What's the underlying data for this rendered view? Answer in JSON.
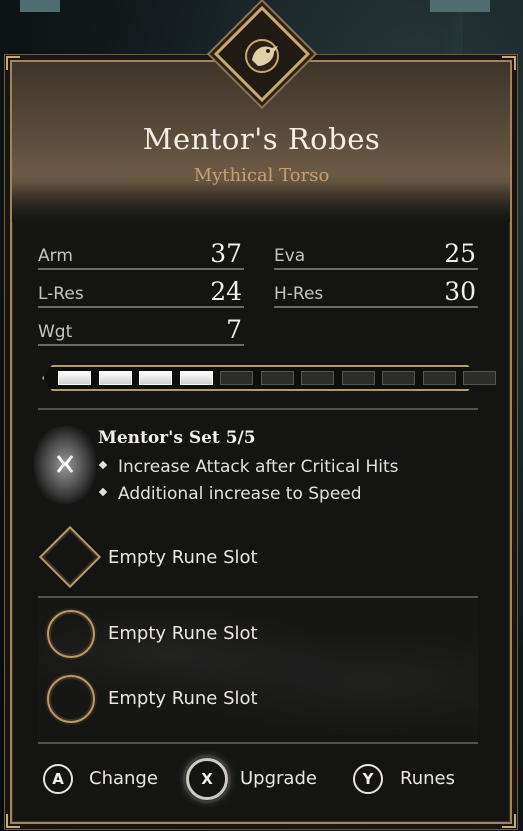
{
  "item": {
    "name": "Mentor's Robes",
    "type": "Mythical Torso",
    "emblem_icon": "raven-icon"
  },
  "stats": [
    {
      "label": "Arm",
      "value": "37"
    },
    {
      "label": "Eva",
      "value": "25"
    },
    {
      "label": "L-Res",
      "value": "24"
    },
    {
      "label": "H-Res",
      "value": "30"
    },
    {
      "label": "Wgt",
      "value": "7"
    }
  ],
  "upgrade_progress": {
    "filled": 4,
    "total": 11
  },
  "set_bonus": {
    "title": "Mentor's Set 5/5",
    "effects": [
      "Increase Attack after Critical Hits",
      "Additional increase to Speed"
    ],
    "rune_icon": "set-rune-icon"
  },
  "rune_slots": [
    {
      "shape": "diamond",
      "label": "Empty Rune Slot"
    },
    {
      "shape": "circle",
      "label": "Empty Rune Slot"
    },
    {
      "shape": "circle",
      "label": "Empty Rune Slot"
    }
  ],
  "actions": [
    {
      "button": "A",
      "label": "Change"
    },
    {
      "button": "X",
      "label": "Upgrade"
    },
    {
      "button": "Y",
      "label": "Runes"
    }
  ],
  "colors": {
    "accent_gold": "#c9a06a",
    "frame": "#b69a6c"
  }
}
